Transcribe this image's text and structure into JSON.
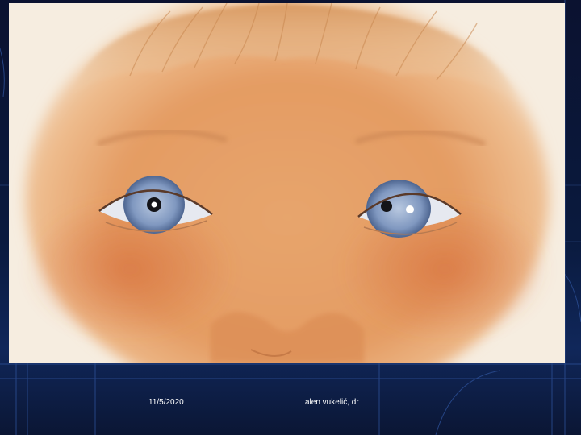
{
  "footer": {
    "date": "11/5/2020",
    "author": "alen vukelić, dr"
  },
  "colors": {
    "background": "#0a1a3e",
    "accent_line": "#2b4f9a",
    "skin": "#e9a06a",
    "iris": "#8fa6c8"
  },
  "icons": {
    "illustration": "child-face-leukocoria-illustration"
  }
}
